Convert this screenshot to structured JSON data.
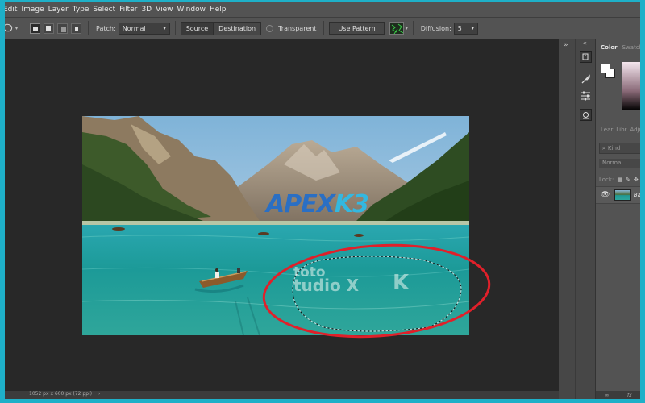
{
  "menu": [
    "Edit",
    "Image",
    "Layer",
    "Type",
    "Select",
    "Filter",
    "3D",
    "View",
    "Window",
    "Help"
  ],
  "options": {
    "patch_label": "Patch:",
    "patch_value": "Normal",
    "source_label": "Source",
    "destination_label": "Destination",
    "transparent_label": "Transparent",
    "use_pattern_label": "Use Pattern",
    "diffusion_label": "Diffusion:",
    "diffusion_value": "5"
  },
  "watermarks": {
    "apex_part1": "APEX",
    "apex_part2": "K3",
    "line1": "toto",
    "line2": "tudio X",
    "line3": "K"
  },
  "panels": {
    "color_tab": "Color",
    "swatches_tab": "Swatch",
    "learn_tab": "Lear",
    "libraries_tab": "Libr",
    "adjustments_tab": "Adju",
    "kind_placeholder": "Kind",
    "blend_mode": "Normal",
    "lock_label": "Lock:",
    "layer_name": "Ba"
  },
  "status": {
    "doc_info": "1052 px x 600 px (72 ppi)"
  },
  "colors": {
    "accent_blue": "#2a6fc4",
    "accent_cyan": "#33b8e0",
    "annotation_red": "#e0202a"
  }
}
